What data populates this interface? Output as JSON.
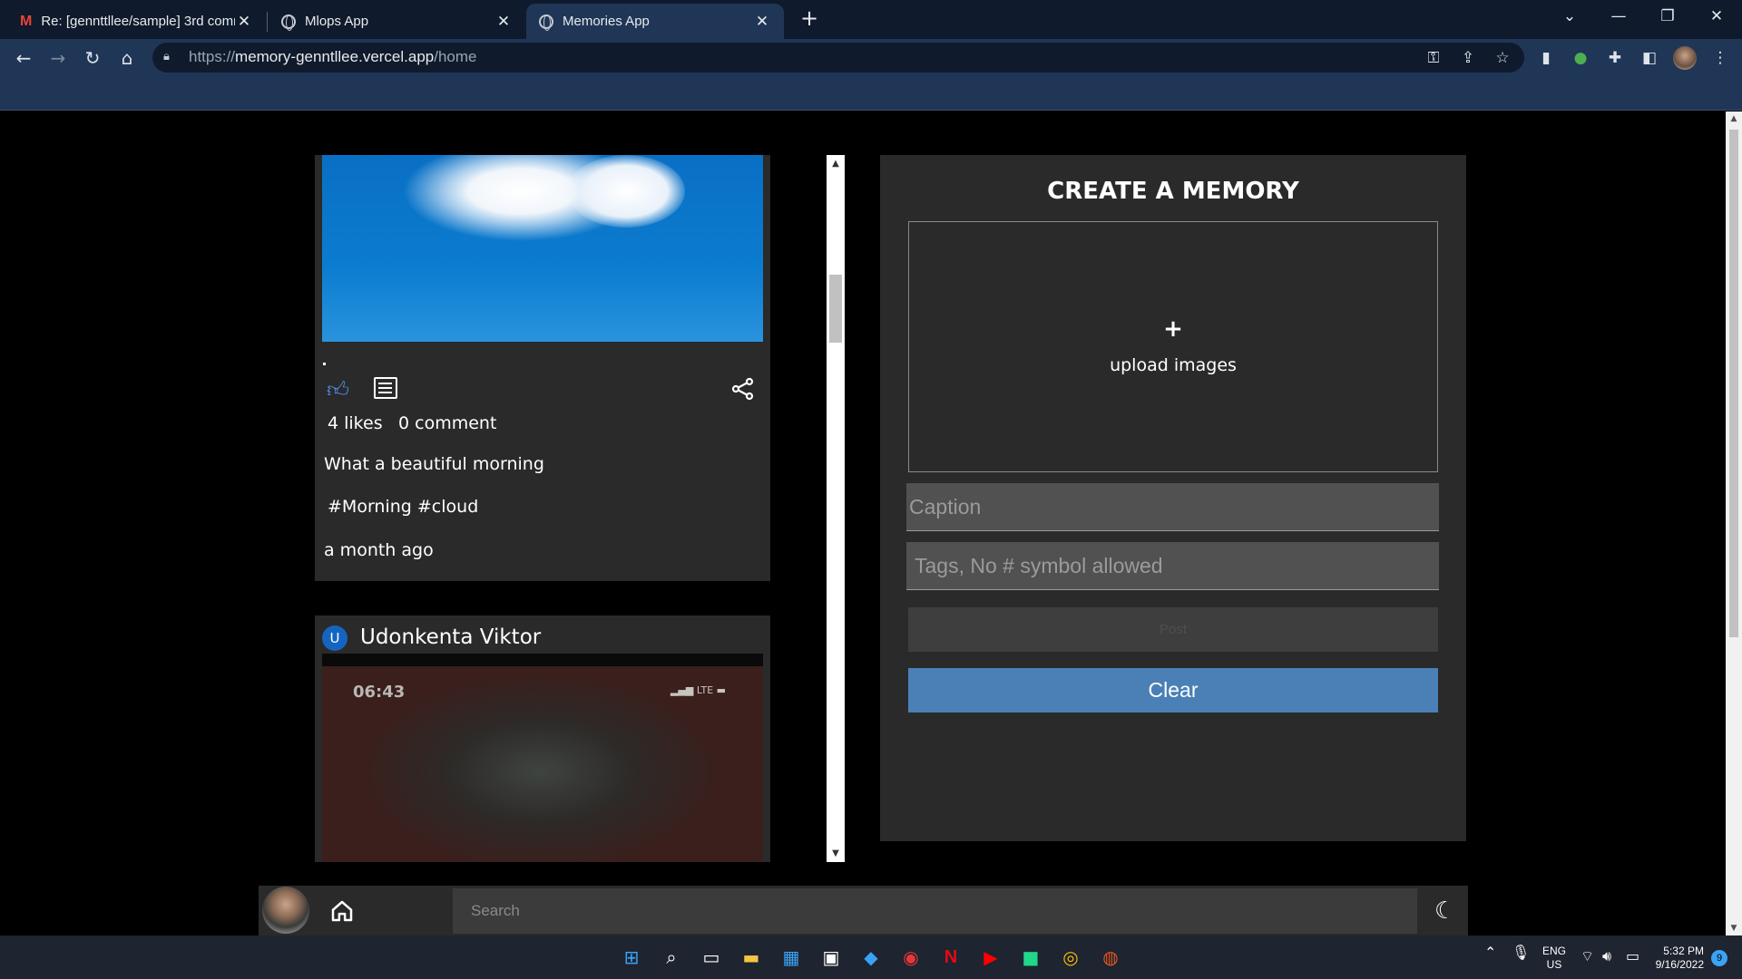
{
  "browser": {
    "tabs": [
      {
        "title": "Re: [gennttllee/sample] 3rd comm",
        "icon": "gmail-icon",
        "active": false
      },
      {
        "title": "Mlops App",
        "icon": "globe-icon",
        "active": false
      },
      {
        "title": "Memories App",
        "icon": "globe-icon",
        "active": true
      }
    ],
    "new_tab_label": "+",
    "url_scheme": "https://",
    "url_host": "memory-genntllee.vercel.app",
    "url_path": "/home"
  },
  "feed": {
    "posts": [
      {
        "likes": "4 likes",
        "comments": "0 comment",
        "caption": "What a beautiful morning",
        "tags": "#Morning #cloud",
        "time": "a month ago",
        "image": "sky-with-cloud"
      },
      {
        "avatar_letter": "U",
        "author": "Udonkenta Viktor",
        "image": "blurred-phone-screenshot",
        "image_time": "06:43",
        "image_status": "LTE"
      }
    ]
  },
  "form": {
    "title": "CREATE A MEMORY",
    "upload_plus": "+",
    "upload_label": "upload images",
    "caption_placeholder": "Caption",
    "tags_placeholder": "Tags, No # symbol allowed",
    "post_label": "Post",
    "clear_label": "Clear"
  },
  "appbar": {
    "search_placeholder": "Search"
  },
  "taskbar": {
    "lang": "ENG",
    "region": "US",
    "time": "5:32 PM",
    "date": "9/16/2022",
    "notification_count": "9"
  },
  "colors": {
    "chrome_dark": "#0f1a2c",
    "chrome_toolbar": "#1f3656",
    "card_bg": "#2a2a2a",
    "accent_blue": "#4a80b6",
    "like_blue": "#4f8de0"
  }
}
